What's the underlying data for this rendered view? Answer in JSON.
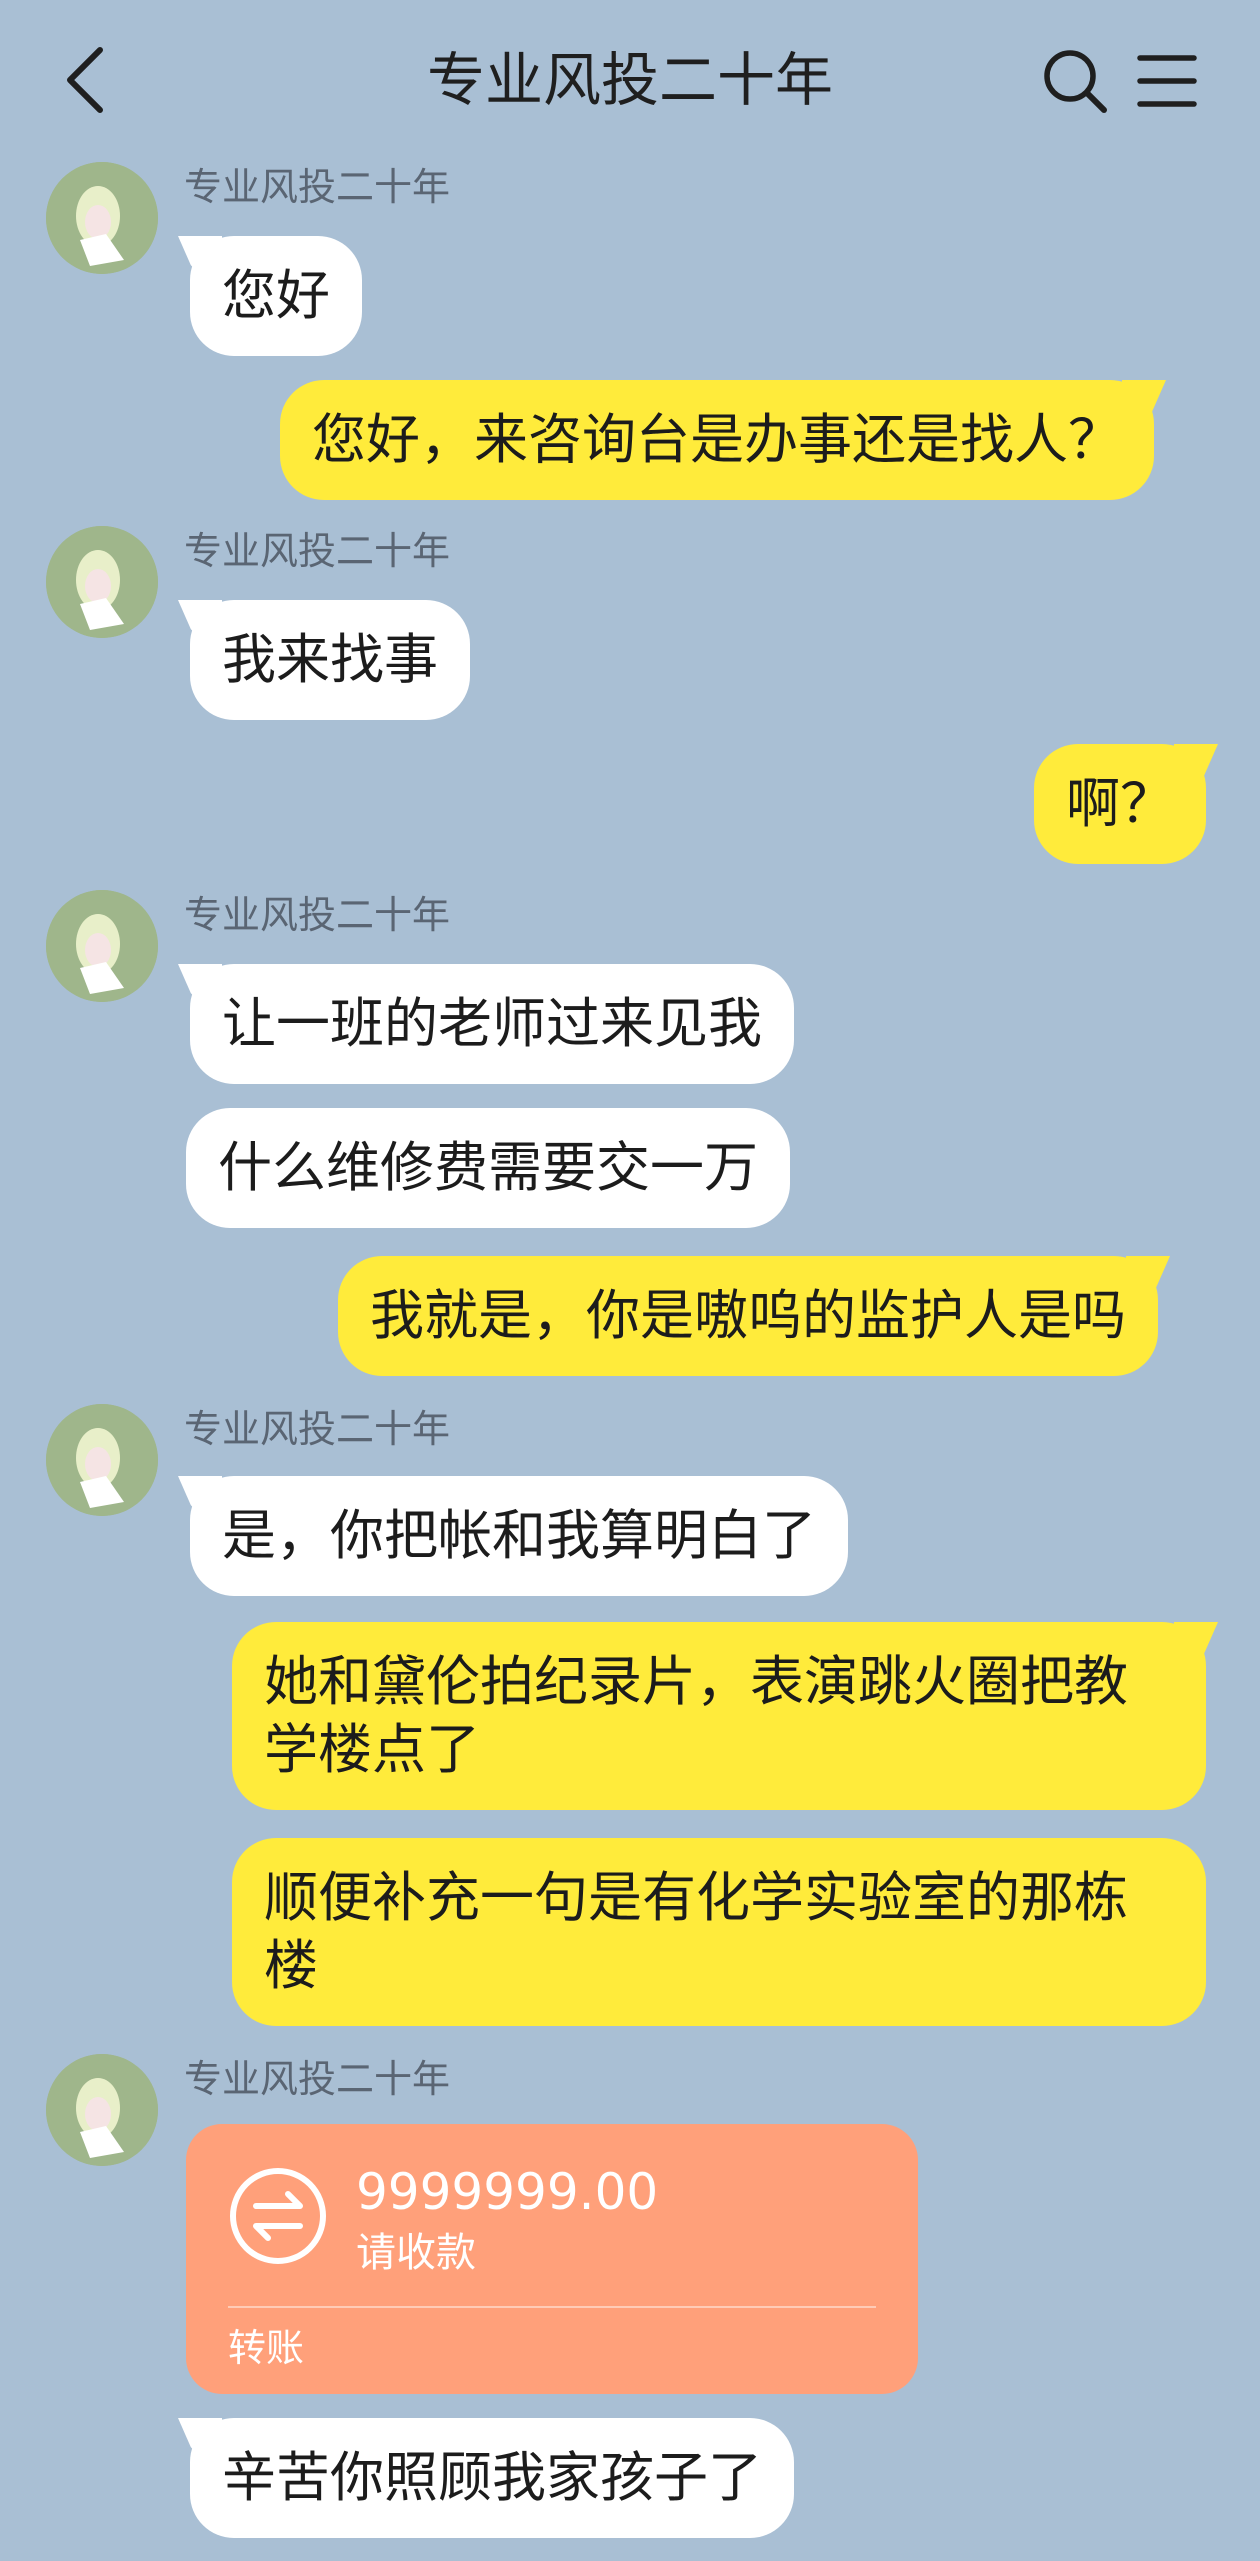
{
  "header": {
    "title": "专业风投二十年",
    "back_icon": "chevron-left-icon",
    "search_icon": "search-icon",
    "menu_icon": "hamburger-menu-icon"
  },
  "colors": {
    "background": "#a9bfd4",
    "incoming_bubble": "#ffffff",
    "outgoing_bubble": "#ffeb3b",
    "transfer_card": "#ffa07a"
  },
  "messages": [
    {
      "sender": "专业风投二十年",
      "text": "您好"
    },
    {
      "text": "您好，来咨询台是办事还是找人？"
    },
    {
      "sender": "专业风投二十年",
      "text": "我来找事"
    },
    {
      "text": "啊？"
    },
    {
      "sender": "专业风投二十年",
      "text": "让一班的老师过来见我"
    },
    {
      "text": "什么维修费需要交一万"
    },
    {
      "text": "我就是，你是嗷呜的监护人是吗"
    },
    {
      "sender": "专业风投二十年",
      "text": "是，你把帐和我算明白了"
    },
    {
      "text": "她和黛伦拍纪录片，表演跳火圈把教学楼点了"
    },
    {
      "text": "顺便补充一句是有化学实验室的那栋楼"
    },
    {
      "sender": "专业风投二十年"
    },
    {
      "text": "辛苦你照顾我家孩子了"
    }
  ],
  "transfer": {
    "amount": "9999999.00",
    "status": "请收款",
    "label": "转账",
    "icon": "exchange-arrows-icon"
  }
}
